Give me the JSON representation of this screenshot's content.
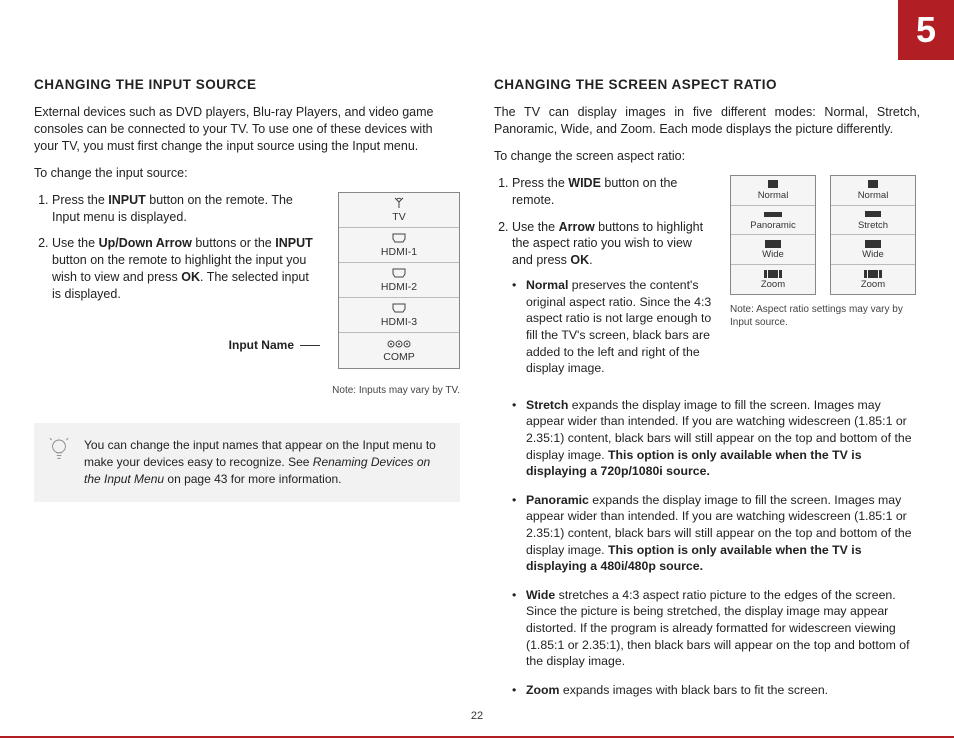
{
  "chapter": "5",
  "page_number": "22",
  "left": {
    "title": "CHANGING THE INPUT SOURCE",
    "intro": "External devices such as DVD players, Blu-ray Players, and video game consoles can be connected to your TV.  To use one of these devices with your TV, you must first change the input source using the Input menu.",
    "lead": "To change the input source:",
    "steps": {
      "s1a": "Press the ",
      "s1_bold": "INPUT",
      "s1b": " button on the remote. The Input menu is displayed.",
      "s2a": "Use the ",
      "s2_bold1": "Up/Down Arrow",
      "s2b": " buttons or the ",
      "s2_bold2": "INPUT",
      "s2c": " button on the remote to highlight the input you wish to view and press ",
      "s2_bold3": "OK",
      "s2d": ". The selected input is displayed."
    },
    "input_label": "Input Name",
    "input_menu": [
      "TV",
      "HDMI-1",
      "HDMI-2",
      "HDMI-3",
      "COMP"
    ],
    "note_inputs": "Note: Inputs may vary by TV.",
    "tip_a": "You can change the input names that appear on the Input menu to make your devices easy to recognize. See ",
    "tip_ital": "Renaming Devices on the Input Menu",
    "tip_b": " on page 43 for more information."
  },
  "right": {
    "title": "CHANGING THE SCREEN ASPECT RATIO",
    "intro": "The TV can display images in five different modes: Normal, Stretch, Panoramic, Wide, and Zoom. Each mode displays the picture differently.",
    "lead": "To change the screen aspect ratio:",
    "steps": {
      "s1a": "Press the ",
      "s1_bold": "WIDE",
      "s1b": " button on the remote.",
      "s2a": "Use the ",
      "s2_bold1": "Arrow",
      "s2b": " buttons to highlight the aspect ratio you wish to view and press ",
      "s2_bold2": "OK",
      "s2c": "."
    },
    "aspect_menus": {
      "a": [
        "Normal",
        "Panoramic",
        "Wide",
        "Zoom"
      ],
      "b": [
        "Normal",
        "Stretch",
        "Wide",
        "Zoom"
      ]
    },
    "note_aspect": "Note: Aspect ratio settings may vary by Input source.",
    "modes": {
      "normal_bold": "Normal",
      "normal": " preserves the content's original aspect ratio. Since the 4:3 aspect ratio is not large enough to fill the TV's screen, black bars are added to the left and right of the display image.",
      "stretch_bold": "Stretch",
      "stretch_a": " expands the display image to fill the screen. Images may appear wider than intended. If you are watching widescreen (1.85:1 or 2.35:1) content, black bars will still appear on the top and bottom of the display image. ",
      "stretch_b_bold": "This option is only available when the TV is displaying a 720p/1080i source.",
      "pano_bold": "Panoramic",
      "pano_a": " expands the display image to fill the screen. Images may appear wider than intended. If you are watching widescreen (1.85:1 or 2.35:1) content, black bars will still appear on the top and bottom of the display image. ",
      "pano_b_bold": "This option is only available when the TV is displaying a 480i/480p source.",
      "wide_bold": "Wide",
      "wide": " stretches a 4:3 aspect ratio picture to the edges of the screen. Since the picture is being stretched, the display image may appear distorted. If the program is already formatted for widescreen viewing (1.85:1 or 2.35:1), then black bars will appear on the top and bottom of the display image.",
      "zoom_bold": "Zoom",
      "zoom": " expands images with black bars to fit the screen."
    }
  }
}
